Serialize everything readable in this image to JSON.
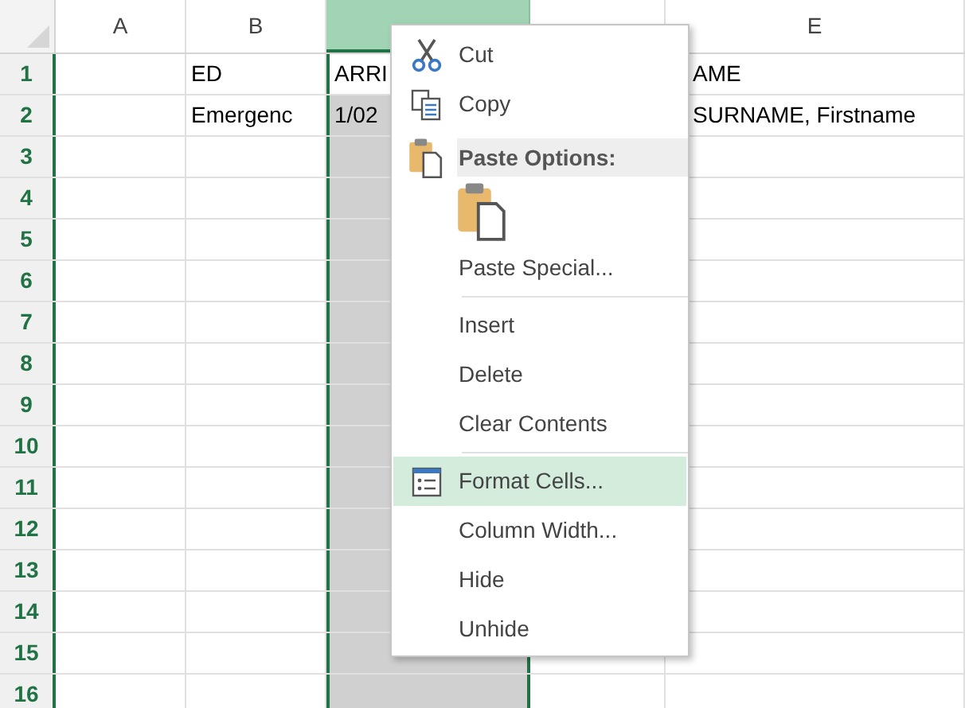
{
  "sheet": {
    "columns": [
      {
        "label": "A",
        "selected": false
      },
      {
        "label": "B",
        "selected": false
      },
      {
        "selected": true
      },
      {
        "selected": false
      },
      {
        "label": "E",
        "selected": false
      }
    ],
    "rows": [
      {
        "number": "1",
        "active": true,
        "cells": {
          "B": "ED",
          "C": "ARRI",
          "E": "AME"
        }
      },
      {
        "number": "2",
        "active": false,
        "cells": {
          "B": "Emergenc",
          "C": "1/02",
          "E": "SURNAME, Firstname"
        }
      },
      {
        "number": "3",
        "active": false
      },
      {
        "number": "4",
        "active": false
      },
      {
        "number": "5",
        "active": false
      },
      {
        "number": "6",
        "active": false
      },
      {
        "number": "7",
        "active": false
      },
      {
        "number": "8",
        "active": false
      },
      {
        "number": "9",
        "active": false
      },
      {
        "number": "10",
        "active": false
      },
      {
        "number": "11",
        "active": false
      },
      {
        "number": "12",
        "active": false
      },
      {
        "number": "13",
        "active": false
      },
      {
        "number": "14",
        "active": false
      },
      {
        "number": "15",
        "active": false
      },
      {
        "number": "16",
        "active": false
      }
    ]
  },
  "context_menu": {
    "items": [
      {
        "kind": "command",
        "label": "Cut",
        "selected": false
      },
      {
        "kind": "command",
        "label": "Copy",
        "selected": false
      },
      {
        "kind": "header",
        "label": "Paste Options:"
      },
      {
        "kind": "paste_button"
      },
      {
        "kind": "command",
        "label": "Paste Special...",
        "selected": false
      },
      {
        "kind": "separator"
      },
      {
        "kind": "command",
        "label": "Insert",
        "selected": false
      },
      {
        "kind": "command",
        "label": "Delete",
        "selected": false
      },
      {
        "kind": "command",
        "label": "Clear Contents",
        "selected": false
      },
      {
        "kind": "separator"
      },
      {
        "kind": "command",
        "label": "Format Cells...",
        "selected": true
      },
      {
        "kind": "command",
        "label": "Column Width...",
        "selected": false
      },
      {
        "kind": "command",
        "label": "Hide",
        "selected": false
      },
      {
        "kind": "command",
        "label": "Unhide",
        "selected": false
      }
    ]
  }
}
